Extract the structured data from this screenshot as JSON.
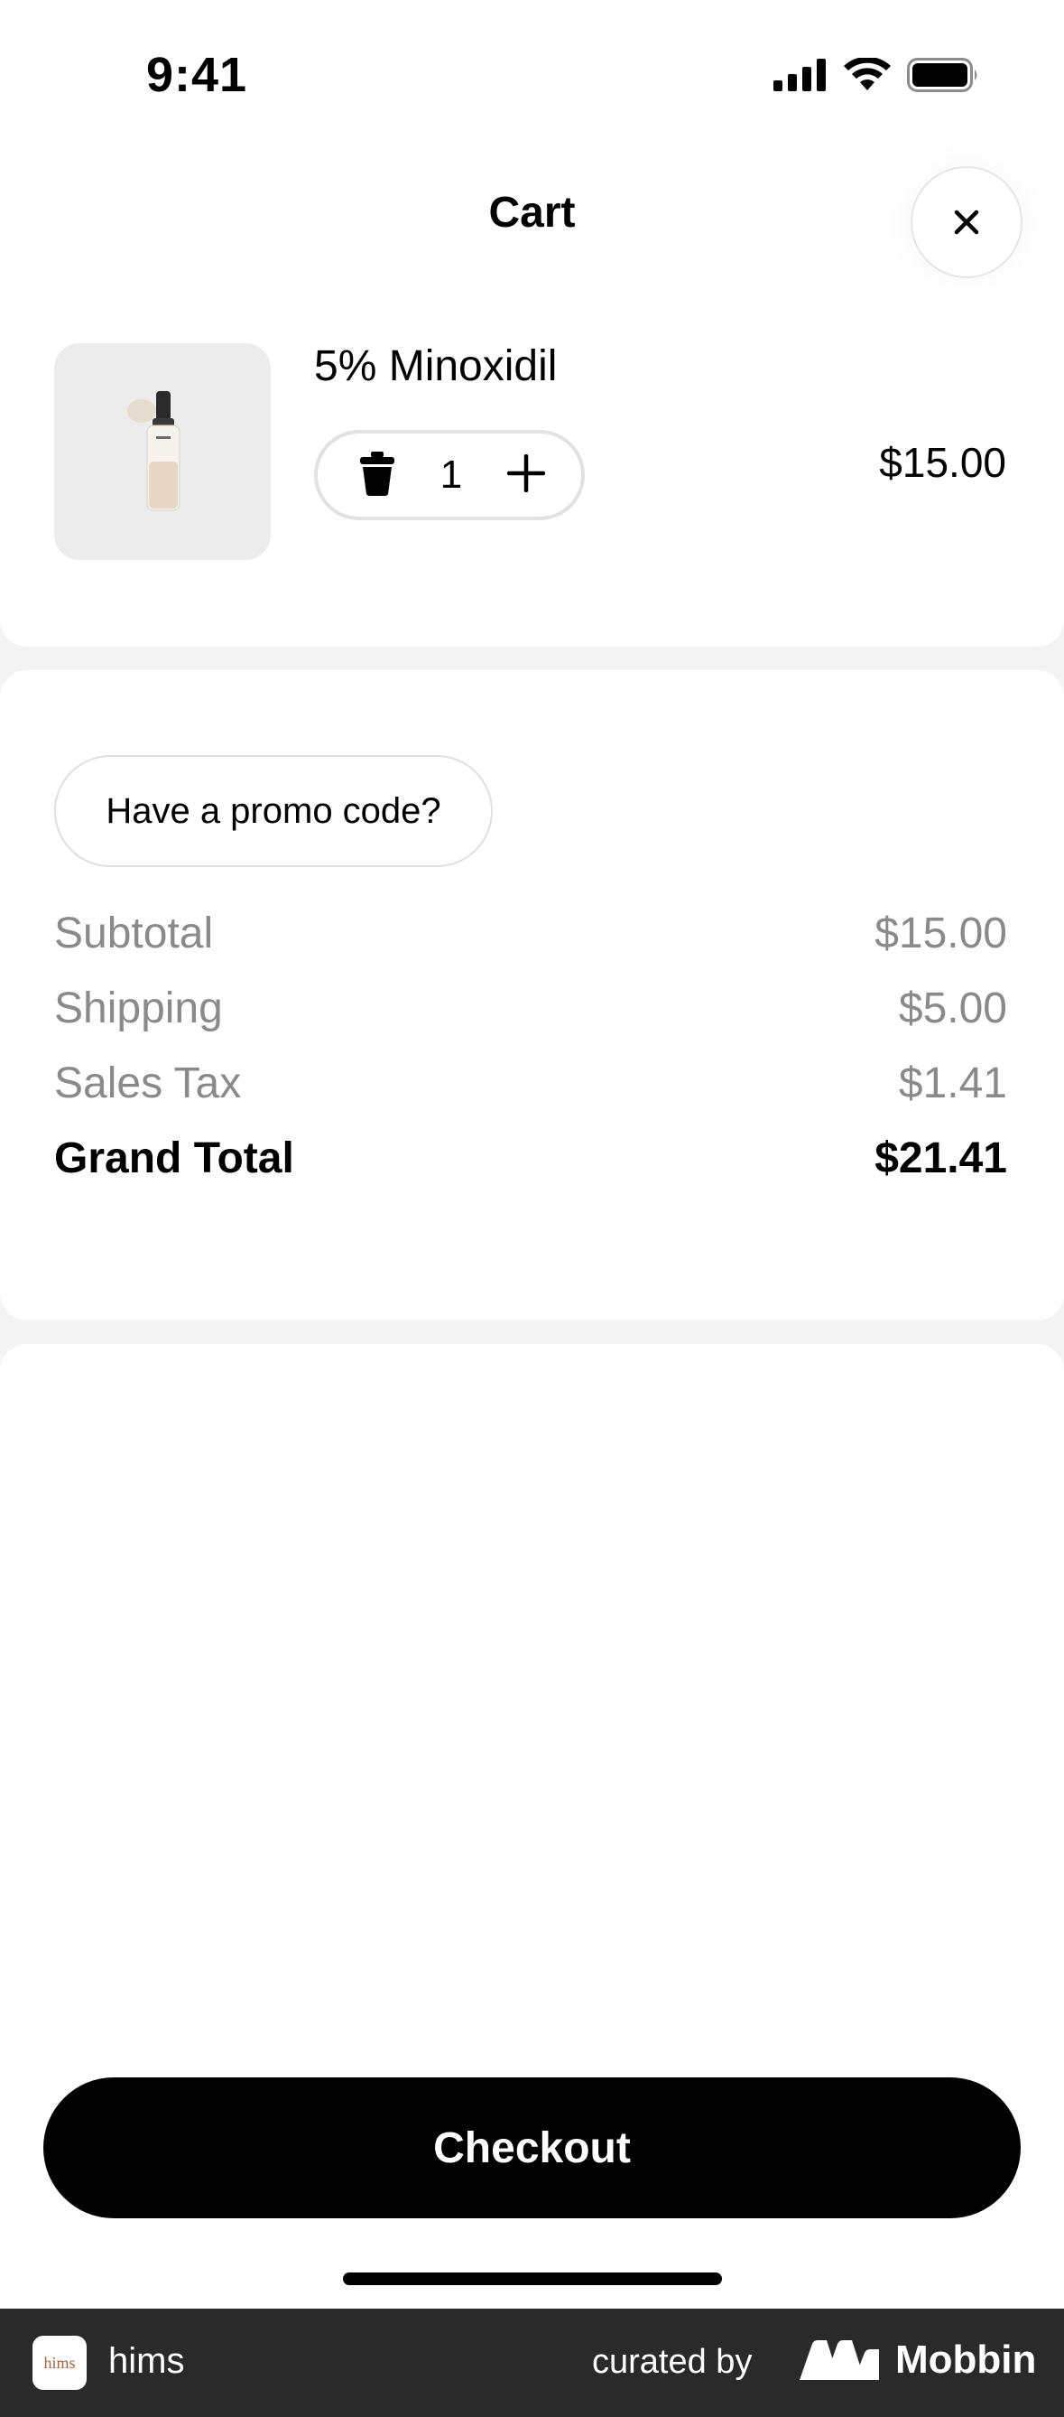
{
  "status_bar": {
    "time": "9:41"
  },
  "header": {
    "title": "Cart"
  },
  "cart_item": {
    "name": "5% Minoxidil",
    "quantity": "1",
    "price": "$15.00"
  },
  "promo": {
    "label": "Have a promo code?"
  },
  "summary": [
    {
      "label": "Subtotal",
      "value": "$15.00"
    },
    {
      "label": "Shipping",
      "value": "$5.00"
    },
    {
      "label": "Sales Tax",
      "value": "$1.41"
    },
    {
      "label": "Grand Total",
      "value": "$21.41"
    }
  ],
  "checkout": {
    "label": "Checkout"
  },
  "footer": {
    "logo_text": "hims",
    "app_name": "hims",
    "curated_by": "curated by",
    "brand": "Mobbin"
  },
  "colors": {
    "background": "#f4f4f4",
    "muted_text": "#8a8a8a",
    "primary_button": "#000000",
    "footer_bg": "#2a2a2a"
  },
  "icons": {
    "close": "close-icon",
    "trash": "trash-icon",
    "plus": "plus-icon",
    "signal": "signal-icon",
    "wifi": "wifi-icon",
    "battery": "battery-icon"
  }
}
